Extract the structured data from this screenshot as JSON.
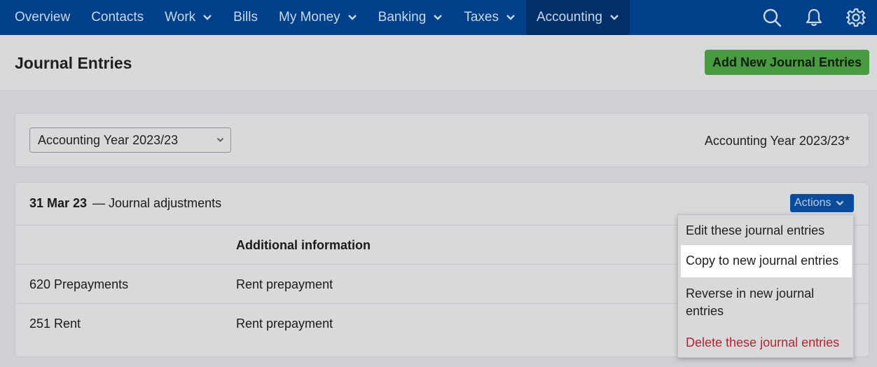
{
  "nav": {
    "items": [
      {
        "label": "Overview"
      },
      {
        "label": "Contacts"
      },
      {
        "label": "Work"
      },
      {
        "label": "Bills"
      },
      {
        "label": "My Money"
      },
      {
        "label": "Banking"
      },
      {
        "label": "Taxes"
      },
      {
        "label": "Accounting"
      }
    ],
    "active": "Accounting",
    "icons": [
      "search-icon",
      "bell-icon",
      "gear-icon"
    ]
  },
  "header": {
    "title": "Journal Entries",
    "add_button_label": "Add New Journal Entries"
  },
  "year_filter": {
    "selected": "Accounting Year 2023/23",
    "label": "Accounting Year 2023/23*"
  },
  "entry": {
    "date": "31 Mar 23",
    "separator": "—",
    "description": "Journal adjustments",
    "actions_label": "Actions",
    "table": {
      "headers": [
        "",
        "Additional information"
      ],
      "rows": [
        [
          "620 Prepayments",
          "Rent prepayment"
        ],
        [
          "251 Rent",
          "Rent prepayment"
        ]
      ]
    }
  },
  "actions_menu": {
    "items": [
      {
        "label": "Edit these journal entries"
      },
      {
        "label": "Copy to new journal entries"
      },
      {
        "label": "Reverse in new journal entries"
      },
      {
        "label": "Delete these journal entries"
      }
    ],
    "highlighted": "Copy to new journal entries"
  },
  "colors": {
    "nav_bg": "#003f8a",
    "add_button": "#4a9a41",
    "actions_button": "#0a4c9b",
    "danger": "#b8232e"
  }
}
